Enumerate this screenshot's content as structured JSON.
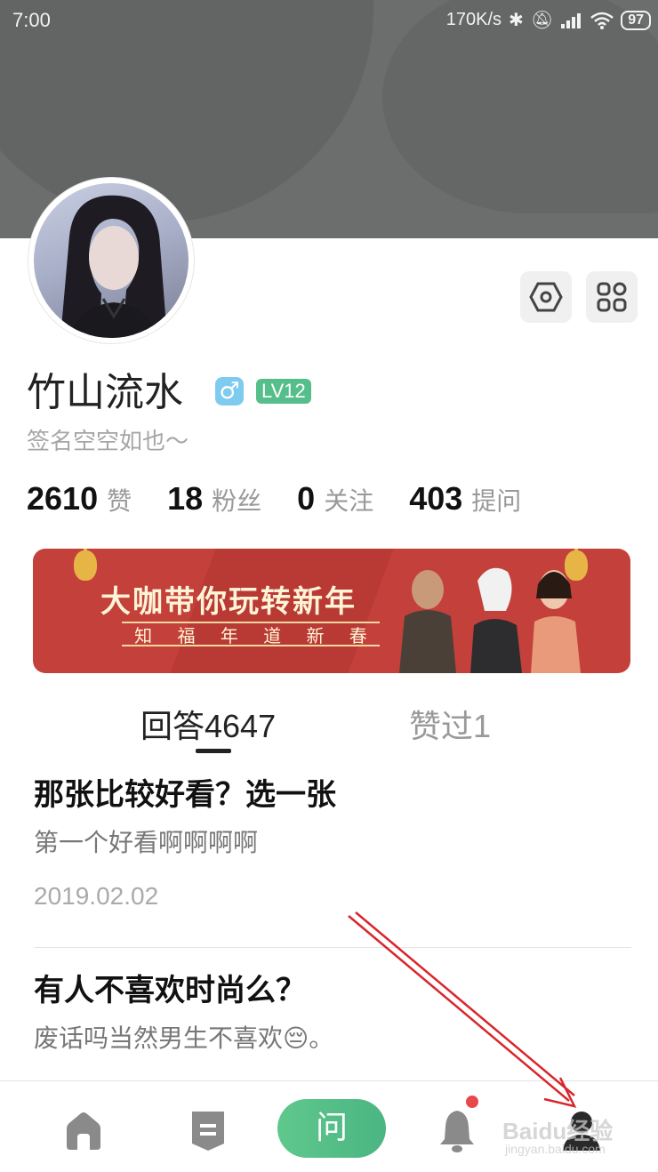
{
  "status_bar": {
    "time": "7:00",
    "network_speed": "170K/s",
    "battery": "97"
  },
  "profile": {
    "name": "竹山流水",
    "gender_symbol": "♂",
    "level": "LV12",
    "signature": "签名空空如也～"
  },
  "stats": [
    {
      "value": "2610",
      "label": "赞"
    },
    {
      "value": "18",
      "label": "粉丝"
    },
    {
      "value": "0",
      "label": "关注"
    },
    {
      "value": "403",
      "label": "提问"
    }
  ],
  "banner": {
    "title": "大咖带你玩转新年",
    "subtitle": [
      "知",
      "福",
      "年",
      "道",
      "新",
      "春"
    ]
  },
  "tabs": {
    "answers": "回答4647",
    "liked": "赞过1"
  },
  "feed": [
    {
      "title": "那张比较好看？选一张",
      "snippet": "第一个好看啊啊啊啊",
      "date": "2019.02.02"
    },
    {
      "title": "有人不喜欢时尚么？",
      "snippet": "废话吗当然男生不喜欢😔。"
    }
  ],
  "bottom_nav": {
    "ask_label": "问",
    "icons": [
      "home-icon",
      "list-icon",
      "bell-icon",
      "profile-icon"
    ]
  },
  "watermark": {
    "main": "Baidu经验",
    "sub": "jingyan.baidu.com"
  },
  "colors": {
    "accent_green": "#56be8a",
    "header_gray": "#6b6e6c",
    "notification_red": "#e8484a",
    "annotation_red": "#d9262c"
  }
}
